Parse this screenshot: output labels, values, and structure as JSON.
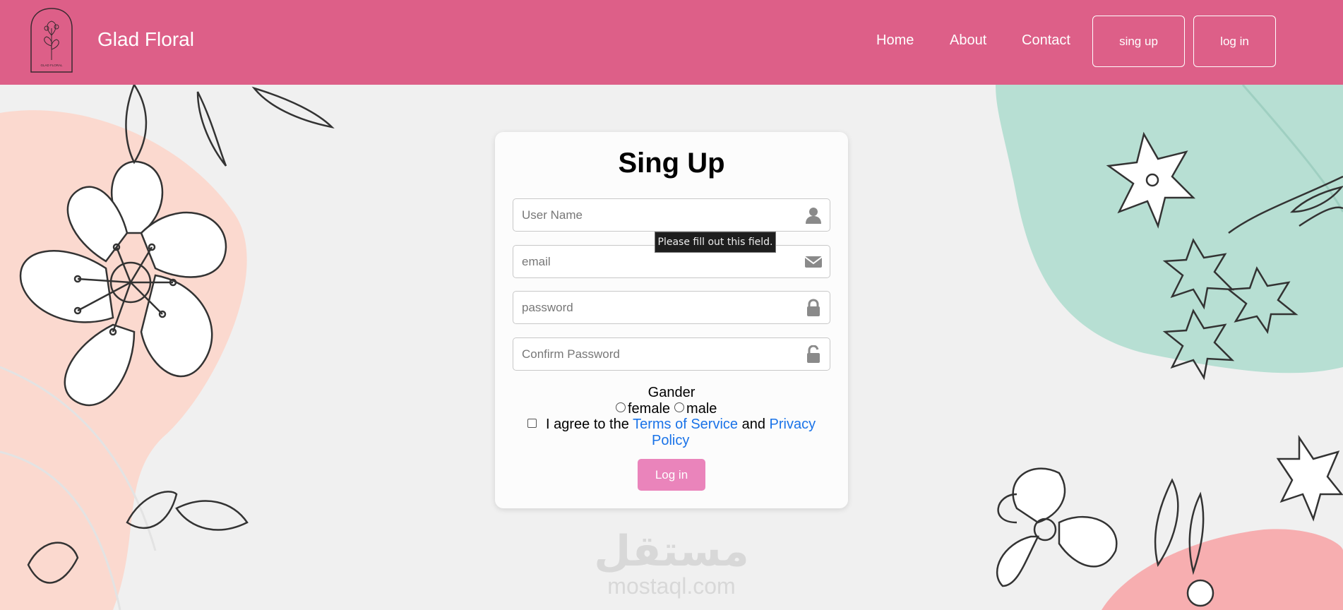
{
  "header": {
    "brand": "Glad Floral",
    "logo_text": "GLAD FLORAL",
    "nav": [
      "Home",
      "About",
      "Contact"
    ],
    "signup_label": "sing up",
    "login_label": "log in"
  },
  "form": {
    "title": "Sing Up",
    "username_placeholder": "User Name",
    "email_placeholder": "email",
    "password_placeholder": "password",
    "confirm_placeholder": "Confirm Password",
    "tooltip": "Please fill out this field.",
    "gender_label": "Gander",
    "gender_options": [
      "female",
      "male"
    ],
    "agree_prefix": "I agree to the",
    "terms_label": "Terms of Service",
    "and_label": "and",
    "privacy_label": "Privacy",
    "privacy_label2": "Policy",
    "submit_label": "Log in"
  },
  "watermark": {
    "arabic": "مستقل",
    "latin": "mostaql.com"
  },
  "colors": {
    "header_bg": "#dd5f88",
    "button_bg": "#ea84bb",
    "link": "#1a73e8",
    "blob_peach": "#fbd9cf",
    "blob_mint": "#b7dfd3",
    "blob_pink": "#f7aeb0"
  }
}
